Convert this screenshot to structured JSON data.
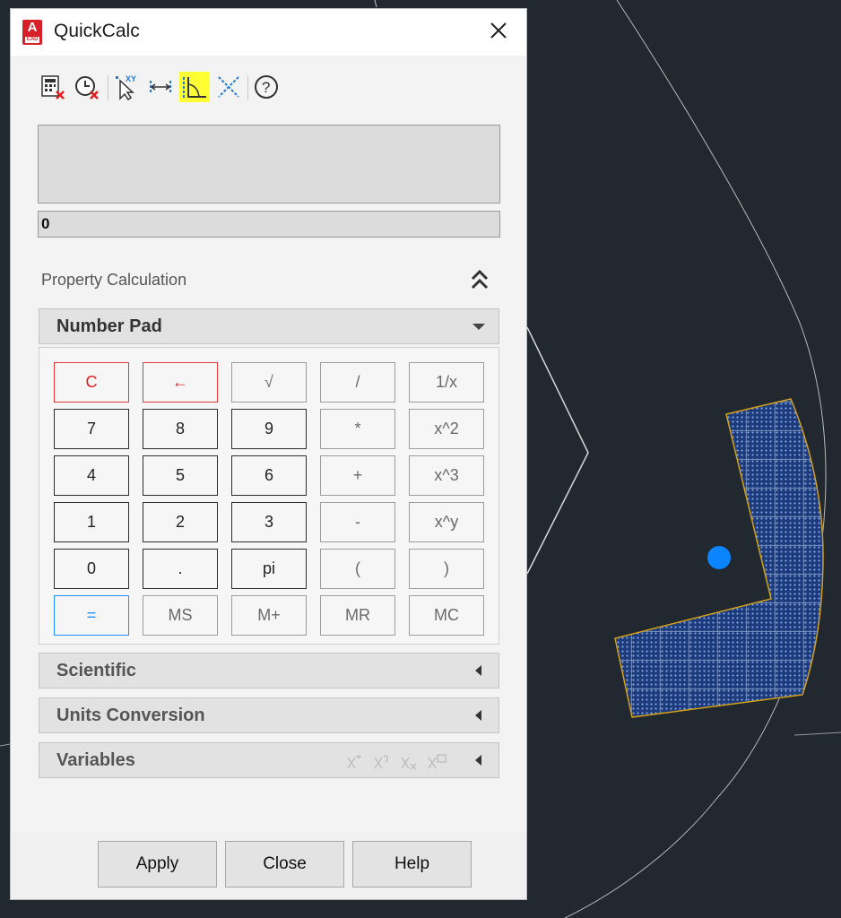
{
  "window": {
    "title": "QuickCalc",
    "app_logo_letter": "A",
    "app_logo_sub": "CAD"
  },
  "toolbar": {
    "buttons": [
      {
        "icon": "clear-calculator-icon"
      },
      {
        "icon": "clear-history-icon"
      },
      {
        "icon": "get-coordinates-icon"
      },
      {
        "icon": "distance-between-points-icon"
      },
      {
        "icon": "angle-of-line-icon",
        "highlighted": true,
        "highlight_color": "#ffff33"
      },
      {
        "icon": "intersection-of-lines-icon"
      },
      {
        "icon": "help-icon"
      }
    ]
  },
  "display": {
    "history": "",
    "value": "0"
  },
  "property_calculation": {
    "label": "Property Calculation"
  },
  "number_pad": {
    "label": "Number Pad",
    "rows": [
      [
        "C",
        "←",
        "√",
        "/",
        "1/x"
      ],
      [
        "7",
        "8",
        "9",
        "*",
        "x^2"
      ],
      [
        "4",
        "5",
        "6",
        "+",
        "x^3"
      ],
      [
        "1",
        "2",
        "3",
        "-",
        "x^y"
      ],
      [
        "0",
        ".",
        "pi",
        "(",
        ")"
      ],
      [
        "=",
        "MS",
        "M+",
        "MR",
        "MC"
      ]
    ]
  },
  "sections": {
    "scientific": "Scientific",
    "units_conversion": "Units Conversion",
    "variables": "Variables"
  },
  "footer": {
    "apply": "Apply",
    "close": "Close",
    "help": "Help"
  },
  "colors": {
    "canvas_bg": "#212830",
    "highlight": "#ffff33",
    "clear_key": "#e02020",
    "equals_key": "#1e90ff",
    "hatch_fill": "#1d3a7a",
    "grip_point": "#0a84ff"
  }
}
